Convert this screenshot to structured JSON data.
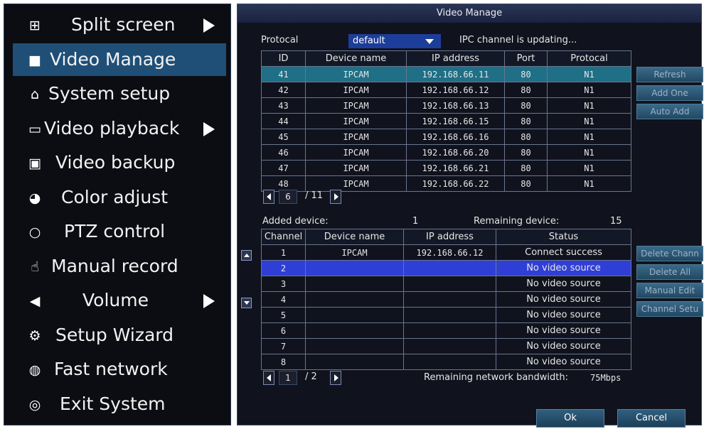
{
  "menu": {
    "items": [
      {
        "label": "Split screen",
        "icon": "grid-icon",
        "glyph": "⊞",
        "arrow": true,
        "active": false
      },
      {
        "label": "Video Manage",
        "icon": "camera-icon",
        "glyph": "■",
        "arrow": false,
        "active": true
      },
      {
        "label": "System setup",
        "icon": "home-icon",
        "glyph": "⌂",
        "arrow": false,
        "active": false
      },
      {
        "label": "Video playback",
        "icon": "film-icon",
        "glyph": "▭",
        "arrow": true,
        "active": false
      },
      {
        "label": "Video backup",
        "icon": "save-icon",
        "glyph": "▣",
        "arrow": false,
        "active": false
      },
      {
        "label": "Color adjust",
        "icon": "palette-icon",
        "glyph": "◕",
        "arrow": false,
        "active": false
      },
      {
        "label": "PTZ control",
        "icon": "ptz-icon",
        "glyph": "○",
        "arrow": false,
        "active": false
      },
      {
        "label": "Manual record",
        "icon": "hand-icon",
        "glyph": "☝",
        "arrow": false,
        "active": false
      },
      {
        "label": "Volume",
        "icon": "speaker-icon",
        "glyph": "◀",
        "arrow": true,
        "active": false
      },
      {
        "label": "Setup Wizard",
        "icon": "gears-icon",
        "glyph": "⚙",
        "arrow": false,
        "active": false
      },
      {
        "label": "Fast network",
        "icon": "globe-icon",
        "glyph": "◍",
        "arrow": false,
        "active": false
      },
      {
        "label": "Exit System",
        "icon": "power-icon",
        "glyph": "◎",
        "arrow": false,
        "active": false
      }
    ]
  },
  "panel": {
    "title": "Video Manage",
    "protocol_label": "Protocal",
    "protocol_value": "default",
    "status": "IPC channel is updating...",
    "ipc_table": {
      "columns": [
        "ID",
        "Device name",
        "IP address",
        "Port",
        "Protocal"
      ],
      "rows": [
        [
          "41",
          "IPCAM",
          "192.168.66.11",
          "80",
          "N1"
        ],
        [
          "42",
          "IPCAM",
          "192.168.66.12",
          "80",
          "N1"
        ],
        [
          "43",
          "IPCAM",
          "192.168.66.13",
          "80",
          "N1"
        ],
        [
          "44",
          "IPCAM",
          "192.168.66.15",
          "80",
          "N1"
        ],
        [
          "45",
          "IPCAM",
          "192.168.66.16",
          "80",
          "N1"
        ],
        [
          "46",
          "IPCAM",
          "192.168.66.20",
          "80",
          "N1"
        ],
        [
          "47",
          "IPCAM",
          "192.168.66.21",
          "80",
          "N1"
        ],
        [
          "48",
          "IPCAM",
          "192.168.66.22",
          "80",
          "N1"
        ]
      ],
      "selected_row": 0,
      "pager": {
        "current": "6",
        "total": "/ 11"
      }
    },
    "side_buttons_top": [
      "Refresh",
      "Add One",
      "Auto Add"
    ],
    "added_label": "Added device:",
    "added_count": "1",
    "remaining_label": "Remaining device:",
    "remaining_count": "15",
    "added_table": {
      "columns": [
        "Channel",
        "Device name",
        "IP address",
        "Status"
      ],
      "rows": [
        [
          "1",
          "IPCAM",
          "192.168.66.12",
          "Connect success"
        ],
        [
          "2",
          "",
          "",
          "No video source"
        ],
        [
          "3",
          "",
          "",
          "No video source"
        ],
        [
          "4",
          "",
          "",
          "No video source"
        ],
        [
          "5",
          "",
          "",
          "No video source"
        ],
        [
          "6",
          "",
          "",
          "No video source"
        ],
        [
          "7",
          "",
          "",
          "No video source"
        ],
        [
          "8",
          "",
          "",
          "No video source"
        ]
      ],
      "selected_row": 1,
      "pager": {
        "current": "1",
        "total": "/ 2"
      }
    },
    "side_buttons_bottom": [
      "Delete Chann",
      "Delete All",
      "Manual Edit",
      "Channel Setu"
    ],
    "bandwidth_label": "Remaining network bandwidth:",
    "bandwidth_value": "75Mbps",
    "ok_label": "Ok",
    "cancel_label": "Cancel"
  }
}
